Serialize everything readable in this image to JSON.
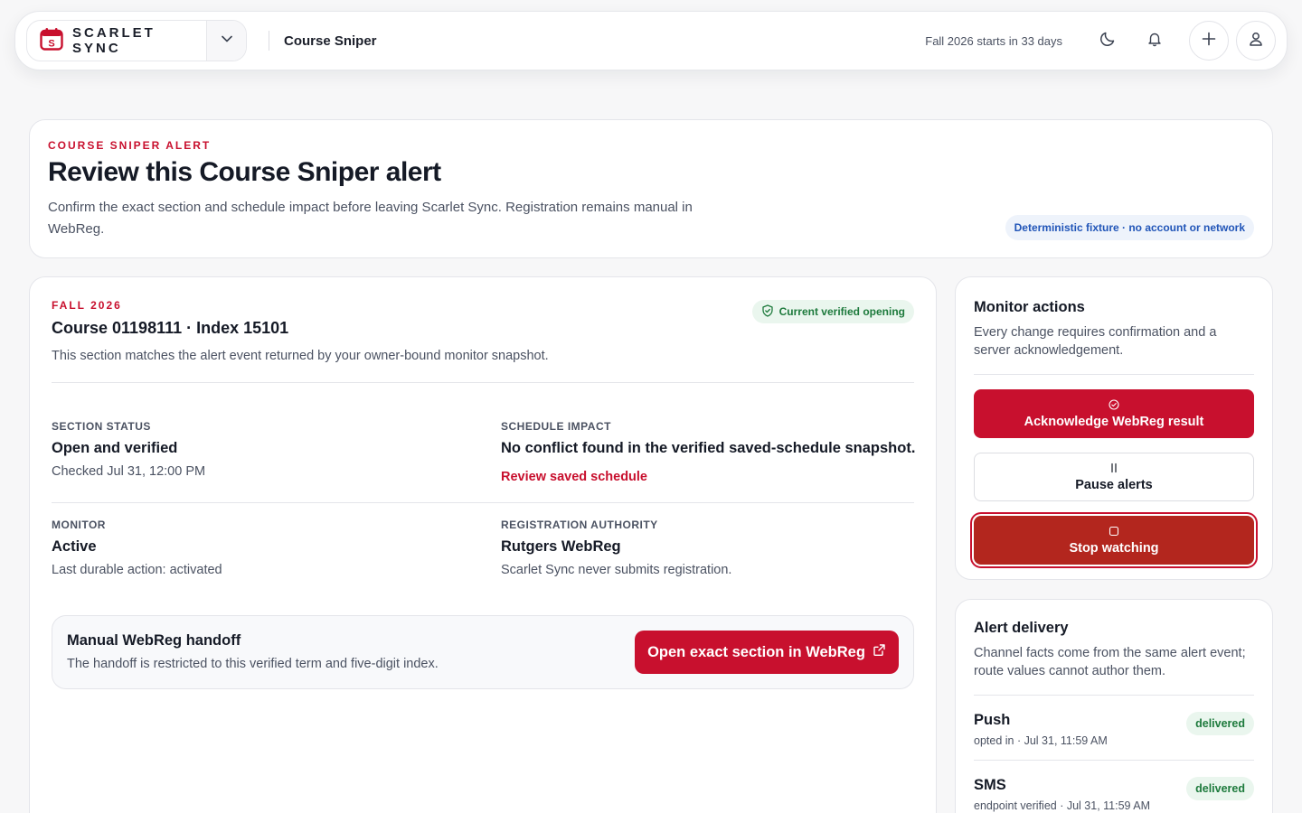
{
  "header": {
    "brand_name": "SCARLET SYNC",
    "page_label": "Course Sniper",
    "term_countdown": "Fall 2026 starts in 33 days",
    "icons": [
      "calendar-logo-icon",
      "chevron-down-icon",
      "moon-icon",
      "bell-icon",
      "plus-icon",
      "user-icon"
    ]
  },
  "hero": {
    "eyebrow": "COURSE SNIPER ALERT",
    "title": "Review this Course Sniper alert",
    "description": "Confirm the exact section and schedule impact before leaving Scarlet Sync. Registration remains manual in WebReg.",
    "fixture_badge": "Deterministic fixture · no account or network"
  },
  "detail": {
    "term": "FALL 2026",
    "course_title": "Course 01198111 · Index 15101",
    "course_sub": "This section matches the alert event returned by your owner-bound monitor snapshot.",
    "verified_pill": "Current verified opening",
    "section_status": {
      "label": "SECTION STATUS",
      "value": "Open and verified",
      "meta": "Checked Jul 31, 12:00 PM"
    },
    "schedule_impact": {
      "label": "SCHEDULE IMPACT",
      "value": "No conflict found in the verified saved-schedule snapshot.",
      "link": "Review saved schedule"
    },
    "monitor": {
      "label": "MONITOR",
      "value": "Active",
      "meta": "Last durable action: activated"
    },
    "registration_authority": {
      "label": "REGISTRATION AUTHORITY",
      "value": "Rutgers WebReg",
      "meta": "Scarlet Sync never submits registration."
    },
    "handoff": {
      "title": "Manual WebReg handoff",
      "description": "The handoff is restricted to this verified term and five-digit index.",
      "button": "Open exact section in WebReg"
    }
  },
  "monitor_actions": {
    "title": "Monitor actions",
    "description": "Every change requires confirmation and a server acknowledgement.",
    "acknowledge": "Acknowledge WebReg result",
    "pause": "Pause alerts",
    "stop": "Stop watching"
  },
  "alert_delivery": {
    "title": "Alert delivery",
    "description": "Channel facts come from the same alert event; route values cannot author them.",
    "channels": [
      {
        "name": "Push",
        "meta": "opted in · Jul 31, 11:59 AM",
        "status": "delivered"
      },
      {
        "name": "SMS",
        "meta": "endpoint verified · Jul 31, 11:59 AM",
        "status": "delivered"
      }
    ]
  },
  "colors": {
    "brand_red": "#c8102e",
    "stop_red": "#b3261e",
    "success_green": "#1d7a3c",
    "info_blue": "#2155b8"
  }
}
